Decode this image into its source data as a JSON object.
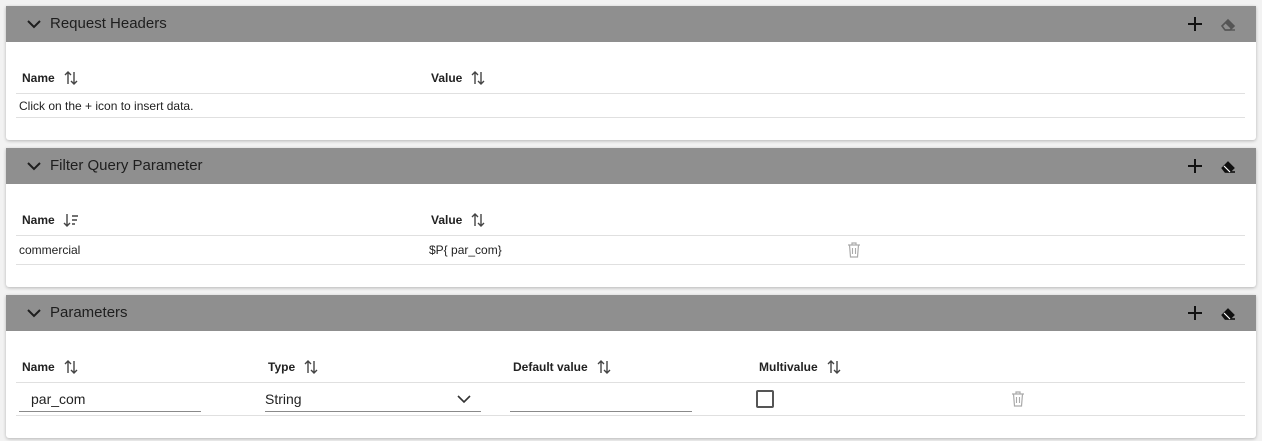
{
  "request_headers": {
    "title": "Request Headers",
    "columns": [
      "Name",
      "Value"
    ],
    "empty_message": "Click on the + icon to insert data."
  },
  "filter_query": {
    "title": "Filter Query Parameter",
    "columns": [
      "Name",
      "Value"
    ],
    "rows": [
      {
        "name": "commercial",
        "value": "$P{ par_com}"
      }
    ]
  },
  "parameters": {
    "title": "Parameters",
    "columns": [
      "Name",
      "Type",
      "Default value",
      "Multivalue"
    ],
    "rows": [
      {
        "name": "par_com",
        "type": "String",
        "default_value": "",
        "multivalue": false
      }
    ]
  },
  "icons": {
    "collapse": "chevron-down-icon",
    "add": "plus-icon",
    "clear": "eraser-icon",
    "sort": "sort-icon",
    "sort_desc": "sort-descending-icon",
    "delete": "trash-icon",
    "dropdown": "chevron-down-icon"
  },
  "colors": {
    "header_bg": "#8f8f8f",
    "panel_bg": "#ffffff",
    "page_bg": "#f2f2f2"
  }
}
